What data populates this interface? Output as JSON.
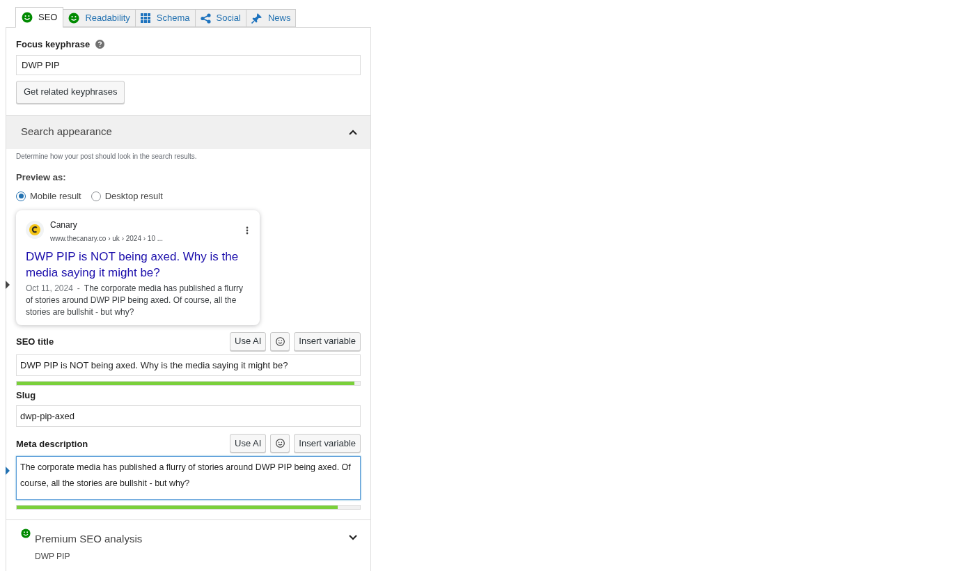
{
  "tabs": [
    {
      "label": "SEO",
      "selected": true
    },
    {
      "label": "Readability",
      "selected": false
    },
    {
      "label": "Schema",
      "selected": false
    },
    {
      "label": "Social",
      "selected": false
    },
    {
      "label": "News",
      "selected": false
    }
  ],
  "focus_keyphrase": {
    "label": "Focus keyphrase",
    "value": "DWP PIP",
    "button": "Get related keyphrases"
  },
  "search_appearance": {
    "title": "Search appearance",
    "expanded": true,
    "description": "Determine how your post should look in the search results.",
    "preview_label": "Preview as:",
    "preview_options": [
      {
        "label": "Mobile result",
        "selected": true
      },
      {
        "label": "Desktop result",
        "selected": false
      }
    ],
    "snippet": {
      "site_name": "Canary",
      "url": "www.thecanary.co › uk › 2024 › 10 ...",
      "title": "DWP PIP is NOT being axed. Why is the media saying it might be?",
      "date": "Oct 11, 2024",
      "separator": "-",
      "description": "The corporate media has published a flurry of stories around DWP PIP being axed. Of course, all the stories are bullshit - but why?"
    },
    "fields": [
      {
        "label": "SEO title",
        "kind": "input",
        "value": "DWP PIP is NOT being axed. Why is the media saying it might be?",
        "focused": false,
        "buttons": [
          "Use AI",
          "Insert variable"
        ],
        "level": 0.984
      },
      {
        "label": "Slug",
        "kind": "input",
        "value": "dwp-pip-axed",
        "focused": false
      },
      {
        "label": "Meta description",
        "kind": "textarea",
        "value": "The corporate media has published a flurry of stories around DWP PIP being axed. Of course, all the stories are bullshit - but why?",
        "focused": true,
        "buttons": [
          "Use AI",
          "Insert variable"
        ],
        "level": 0.935
      }
    ]
  },
  "premium_analysis": {
    "title": "Premium SEO analysis",
    "subtitle": "DWP PIP",
    "expanded": false
  }
}
